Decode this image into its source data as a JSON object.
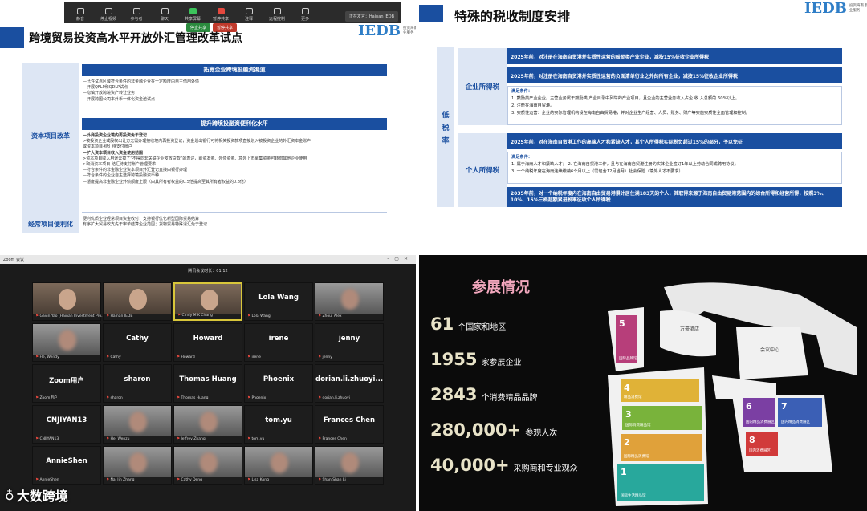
{
  "q1": {
    "toolbar": [
      "静音",
      "停止视频",
      "参与者",
      "聊天",
      "共享屏幕",
      "暂停共享",
      "注释",
      "远程控制",
      "更多"
    ],
    "speaker": "正在发言：Hainan IEDB",
    "share": [
      "停止共享",
      "暂停共享",
      "新的共享"
    ],
    "title": "跨境贸易投资高水平开放外汇管理改革试点",
    "logo": {
      "ie": "IEDB",
      "sub": "投资海南 我们为企业服务"
    },
    "side": [
      "资本项目改革",
      "经常项目便利化"
    ],
    "bar1": "拓宽企业跨境投融资渠道",
    "lines1": [
      "—允许试点区域符合条件的非金融企业在一定额度内自主借用外债",
      "—开展QFLP和QDLP试点",
      "—稳慎开放跨境资产转让业务",
      "—开展跨国公司本外币一体化资金池试点"
    ],
    "bar2": "提升跨境投融资便利化水平",
    "lines2": [
      {
        "t": "—外商投资企业境内再投资免于登记",
        "b": true
      },
      {
        "t": " >被投资企业或股权出让方无需办理接收境内再投资登记，资金划出银行可将相关投资款项直接划入被投资企业的外汇资本金账户",
        "b": false
      },
      {
        "t": "  或资本项目-结汇待支付账户",
        "b": false
      },
      {
        "t": "—扩大资本项目收入资金使用范围",
        "b": true
      },
      {
        "t": " >资本项目收入用途去掉了“不得向非关联企业发放贷款”的表述，即资本金、外债资金、境外上市募集资金可转借其他企业使用",
        "b": false
      },
      {
        "t": " >取消资本项目-结汇待支付账户管理要求",
        "b": false
      },
      {
        "t": "—符合条件的非金融企业资本项目外汇登记直接由银行办理",
        "b": false
      },
      {
        "t": "—符合条件的企业自主选择跨境投融资币种",
        "b": false
      },
      {
        "t": "—适度提高非金融企业外债额度上限（由其所有者权益的0.5倍提高至其所有者权益的0.8倍）",
        "b": false
      }
    ],
    "lines3": [
      "便利优质企业经常项目资金收付：支持银行优化新型国际贸易结算",
      "有序扩大贸易收支先于审单结算企业范围；货物贸易特殊退汇免于登记"
    ]
  },
  "q2": {
    "title": "特殊的税收制度安排",
    "logo": {
      "ie": "IEDB",
      "sub": "投资海南 我们为企业服务"
    },
    "low": [
      "低",
      "税",
      "率"
    ],
    "secs": [
      "企业所得税",
      "个人所得税"
    ],
    "b1": "2025年前，对注册在海南自贸港并实质性运营的鼓励类产业企业，减按15%征收企业所得税",
    "b2": "2025年前，对注册在海南自贸港并实质性运营的负面清单行业之外的所有企业，减按15%征收企业所得税",
    "c1h": "满足条件：",
    "c1": [
      "1. 鼓励类产业企业。主营业务属于鼓励类 产业目录中列举的产业项目，且企业的主营业务收入占企 收 入总额的 60%以上。",
      "2. 注册在海南自贸港。",
      "3. 实质性运营：企业的实际管理机构设在海南自由贸易港，并对企业生产经营、人员、账务、财产等实施实质性全面管理和控制。"
    ],
    "b3": "2025年前，对在海南自贸港工作的高端人才和紧缺人才，其个人所得税实际税负超过15%的部分，予以免征",
    "c2h": "满足条件：",
    "c2": [
      "1. 属于海南人才和紧缺人才； 2. 在海南自贸港工作，且与在海南自贸港注册的实体企业签订1年以上劳动合同或聘用协议；",
      "3. 一个纳税年度在海南连续缴纳6个月以上（需包含12月当月）社会保险（境外人才不要求）"
    ],
    "b4": "2035年前，对一个纳税年度内在海南自由贸易港累计居住满183天的个人，其取得来源于海南自由贸易港范围内的综合所得和经营所得，按照3%、10%、15%三档超额累进税率征收个人所得税"
  },
  "q3": {
    "head": "Zoom 会议",
    "sub": "腾讯会议时长：01:12",
    "tiles": [
      {
        "name": "",
        "foot": "Gavin Yao (Hainan Investment Pro...",
        "video": "group",
        "sp": false
      },
      {
        "name": "",
        "foot": "Hainan IEDB",
        "video": "group",
        "sp": false
      },
      {
        "name": "",
        "foot": "Cindy M K Chang",
        "video": "face",
        "sp": true
      },
      {
        "name": "Lola Wang",
        "foot": "Lola Wang",
        "video": "",
        "sp": false
      },
      {
        "name": "",
        "foot": "Zhou, Alex",
        "video": "blur",
        "sp": false
      },
      {
        "name": "",
        "foot": "He, Wendy",
        "video": "blur",
        "sp": false
      },
      {
        "name": "Cathy",
        "foot": "Cathy",
        "video": "",
        "sp": false
      },
      {
        "name": "Howard",
        "foot": "Howard",
        "video": "",
        "sp": false
      },
      {
        "name": "irene",
        "foot": "irene",
        "video": "",
        "sp": false
      },
      {
        "name": "jenny",
        "foot": "jenny",
        "video": "",
        "sp": false
      },
      {
        "name": "Zoom用户",
        "foot": "Zoom用户",
        "video": "",
        "sp": false
      },
      {
        "name": "sharon",
        "foot": "sharon",
        "video": "",
        "sp": false
      },
      {
        "name": "Thomas Huang",
        "foot": "Thomas Huang",
        "video": "",
        "sp": false
      },
      {
        "name": "Phoenix",
        "foot": "Phoenix",
        "video": "",
        "sp": false
      },
      {
        "name": "dorian.li.zhuoyi...",
        "foot": "dorian.li.zhuoyi",
        "video": "",
        "sp": false
      },
      {
        "name": "CNJIYAN13",
        "foot": "CNJIYAN13",
        "video": "",
        "sp": false
      },
      {
        "name": "",
        "foot": "He, Wenzu",
        "video": "blur",
        "sp": false
      },
      {
        "name": "",
        "foot": "Jeffrey Zhang",
        "video": "blur",
        "sp": false
      },
      {
        "name": "tom.yu",
        "foot": "tom.yu",
        "video": "",
        "sp": false
      },
      {
        "name": "Frances Chen",
        "foot": "Frances Chen",
        "video": "",
        "sp": false
      },
      {
        "name": "AnnieShen",
        "foot": "AnnieShen",
        "video": "",
        "sp": false
      },
      {
        "name": "",
        "foot": "Nai Jin Zhang",
        "video": "blur",
        "sp": false
      },
      {
        "name": "",
        "foot": "Cathy Deng",
        "video": "blur",
        "sp": false
      },
      {
        "name": "",
        "foot": "Lisa Kong",
        "video": "blur",
        "sp": false
      },
      {
        "name": "",
        "foot": "Shan Shan Li",
        "video": "blur",
        "sp": false
      }
    ]
  },
  "q4": {
    "title": "参展情况",
    "stats": [
      {
        "n": "61",
        "l": "个国家和地区"
      },
      {
        "n": "1955",
        "l": "家参展企业"
      },
      {
        "n": "2843",
        "l": "个消费精品品牌"
      },
      {
        "n": "280,000+",
        "l": "参观人次"
      },
      {
        "n": "40,000+",
        "l": "采购商和专业观众"
      }
    ],
    "halls": [
      {
        "num": "5",
        "name": "国际品牌馆",
        "color": "#b73e7a"
      },
      {
        "num": "4",
        "name": "精品消费馆",
        "color": "#e0b237"
      },
      {
        "num": "3",
        "name": "国际消费精品馆",
        "color": "#79b33b"
      },
      {
        "num": "2",
        "name": "国际精品消费馆",
        "color": "#e0a13a"
      },
      {
        "num": "1",
        "name": "国际生活精品馆",
        "color": "#28a89c"
      },
      {
        "num": "6",
        "name": "国内精品消费展区",
        "color": "#7b3fa3"
      },
      {
        "num": "7",
        "name": "国内精品消费展区",
        "color": "#3b5fb5"
      },
      {
        "num": "8",
        "name": "国内消费展区",
        "color": "#d13a3a"
      }
    ],
    "labels": [
      "万豪酒店",
      "会议中心"
    ]
  },
  "watermark": "大数跨境"
}
